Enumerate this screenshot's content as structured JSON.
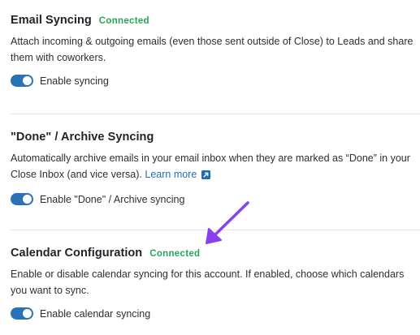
{
  "sections": [
    {
      "title": "Email Syncing",
      "status": "Connected",
      "description": "Attach incoming & outgoing emails (even those sent outside of Close) to Leads and share them with coworkers.",
      "toggle": {
        "label": "Enable syncing",
        "enabled": true
      }
    },
    {
      "title": "\"Done\" / Archive Syncing",
      "description": "Automatically archive emails in your email inbox when they are marked as “Done” in your Close Inbox (and vice versa).",
      "link": {
        "label": "Learn more",
        "icon": "external-link-icon"
      },
      "toggle": {
        "label": "Enable \"Done\" / Archive syncing",
        "enabled": true
      }
    },
    {
      "title": "Calendar Configuration",
      "status": "Connected",
      "description": "Enable or disable calendar syncing for this account. If enabled, choose which calendars you want to sync.",
      "toggle": {
        "label": "Enable calendar syncing",
        "enabled": true
      }
    }
  ],
  "colors": {
    "connected": "#27a35a",
    "toggle_on": "#2a72b8",
    "link": "#1f6fb5",
    "annotation_arrow": "#8a3ff0"
  }
}
